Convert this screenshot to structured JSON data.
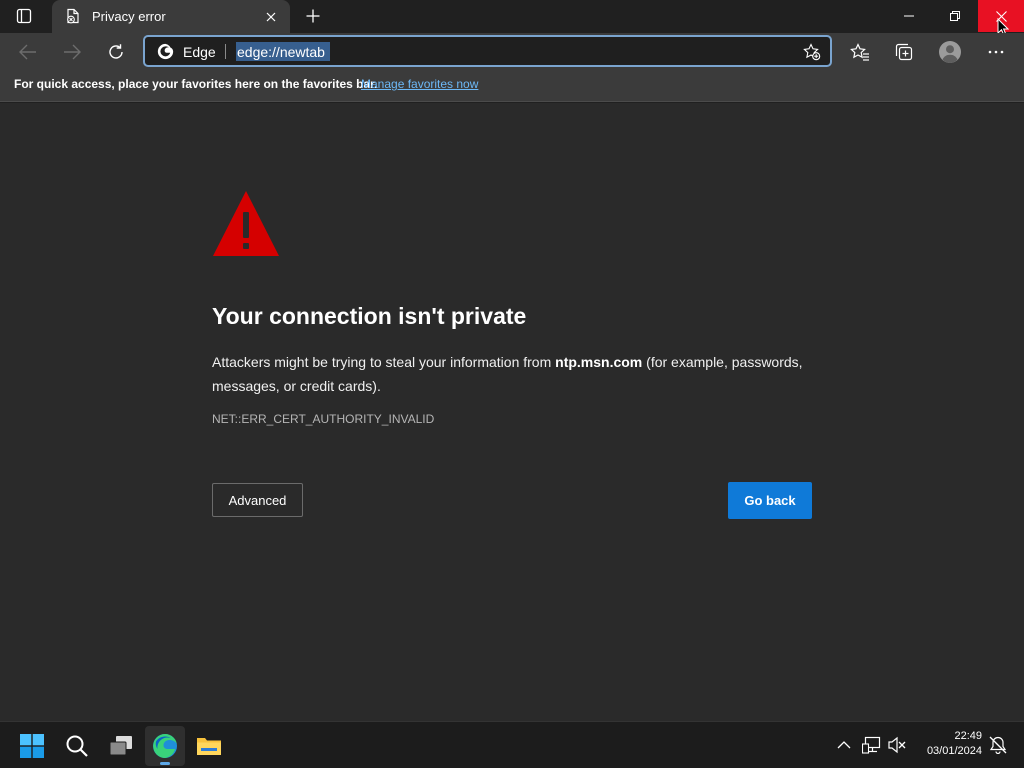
{
  "tab": {
    "title": "Privacy error"
  },
  "address_bar": {
    "brand_label": "Edge",
    "url": "edge://newtab"
  },
  "favorites_bar": {
    "message": "For quick access, place your favorites here on the favorites bar.",
    "link_label": "Manage favorites now"
  },
  "error_page": {
    "heading": "Your connection isn't private",
    "description_before": "Attackers might be trying to steal your information from ",
    "description_host": "ntp.msn.com",
    "description_after": " (for example, passwords, messages, or credit cards).",
    "error_code": "NET::ERR_CERT_AUTHORITY_INVALID",
    "advanced_button": "Advanced",
    "go_back_button": "Go back"
  },
  "taskbar": {
    "apps": [
      "start-icon",
      "search-icon",
      "task-view-icon",
      "edge-icon",
      "file-explorer-icon"
    ],
    "time": "22:49",
    "date": "03/01/2024"
  },
  "colors": {
    "window_close": "#e81123",
    "primary_button": "#0f7ad8",
    "warning_icon": "#d50000",
    "link": "#6cb8f6",
    "page_background": "#2a2a2a"
  }
}
